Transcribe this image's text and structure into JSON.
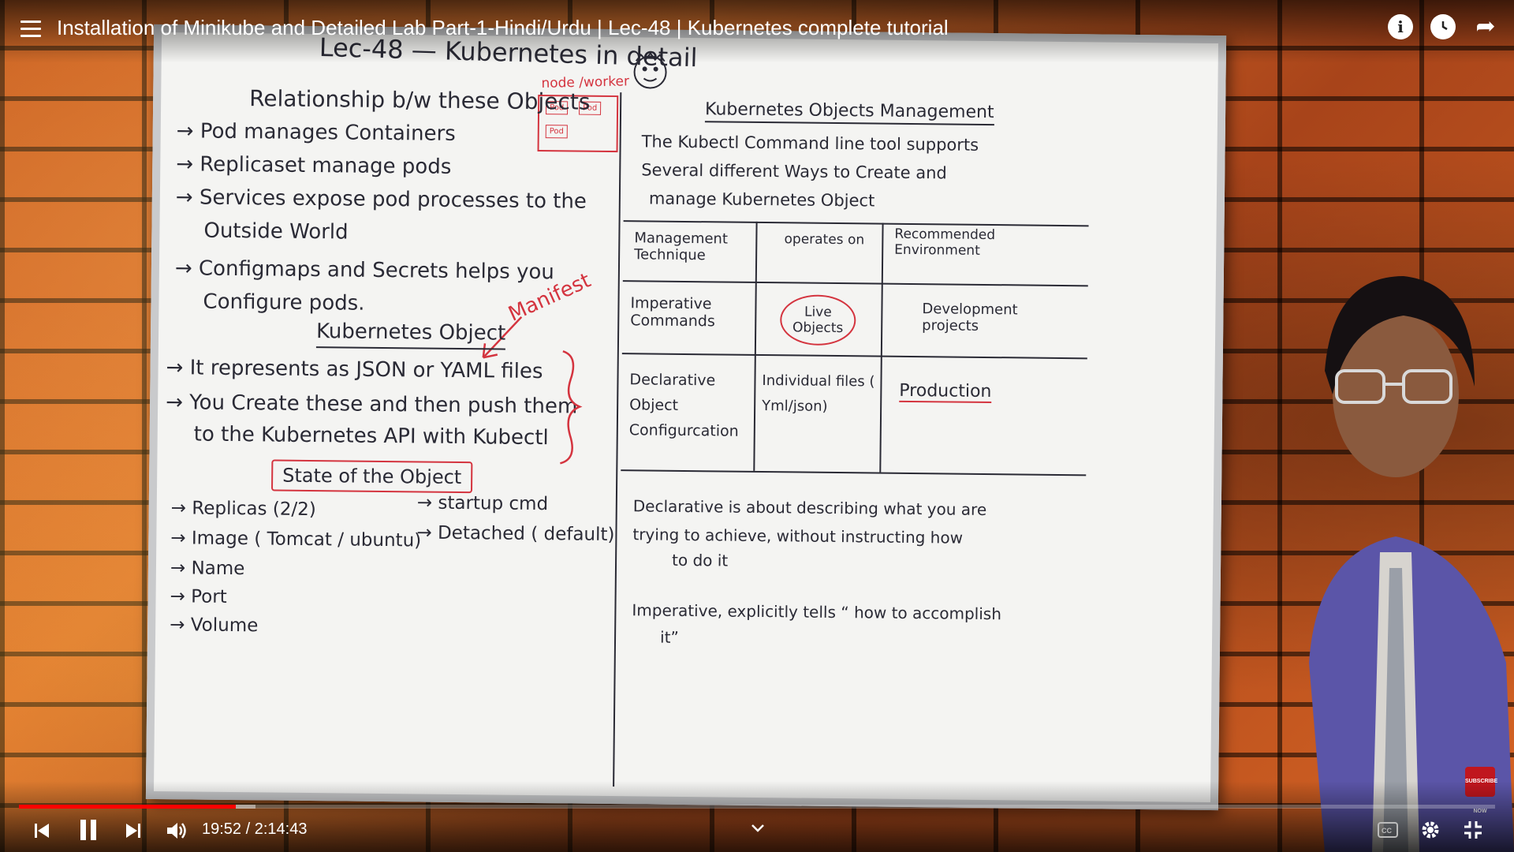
{
  "video": {
    "title": "Installation of Minikube and Detailed Lab Part-1-Hindi/Urdu | Lec-48 | Kubernetes complete tutorial",
    "current_time": "19:52",
    "duration": "2:14:43",
    "time_display": "19:52 / 2:14:43",
    "progress_fraction": 0.147,
    "buffered_fraction": 0.16
  },
  "top_controls": {
    "info_icon": "info-icon",
    "watch_later_icon": "clock-icon",
    "share_icon": "share-icon"
  },
  "bottom_controls": {
    "prev_icon": "skip-previous-icon",
    "pause_icon": "pause-icon",
    "next_icon": "skip-next-icon",
    "volume_icon": "volume-icon",
    "chapters_icon": "chevron-down-icon",
    "cc_icon": "captions-icon",
    "settings_icon": "gear-icon",
    "fullscreen_icon": "exit-fullscreen-icon"
  },
  "colors": {
    "progress_played": "#ff0000",
    "marker_red": "#d4343f",
    "marker_dark": "#2a2a35"
  },
  "board": {
    "header": "Lec-48 — Kubernetes in detail",
    "node_label": "node /worker",
    "pod_box_1": "Pod",
    "pod_box_2": "Pod",
    "pod_box_3": "Pod",
    "left": {
      "heading": "Relationship b/w these Objects",
      "points": [
        "→ Pod manages Containers",
        "→ Replicaset manage pods",
        "→ Services expose pod processes to the",
        "Outside World",
        "→ Configmaps and Secrets helps you",
        "Configure pods."
      ],
      "manifest": "Manifest",
      "object_heading": "Kubernetes Object",
      "object_points": [
        "→ It represents as JSON or YAML files",
        "→ You Create these and then push them",
        "to the Kubernetes API with Kubectl"
      ],
      "state_box": "State of the Object",
      "state_items": [
        "→ Replicas (2/2)",
        "→ Image ( Tomcat / ubuntu)",
        "→ Name",
        "→ Port",
        "→ Volume"
      ],
      "state_right": [
        "→ startup cmd",
        "→ Detached ( default)"
      ]
    },
    "right": {
      "heading": "Kubernetes Objects Management",
      "intro": [
        "The Kubectl Command line tool supports",
        "Several different Ways to Create and",
        "manage Kubernetes Object"
      ],
      "table": {
        "headers": [
          "Management Technique",
          "operates on",
          "Recommended Environment"
        ],
        "rows": [
          [
            "Imperative Commands",
            "Live Objects",
            "Development projects"
          ],
          [
            "Declarative Object Configurcation",
            "Individual files ( Yml/json)",
            "Production"
          ]
        ]
      },
      "notes": [
        "Declarative is about describing what you are",
        "trying to achieve, without instructing how",
        "to do it",
        "Imperative, explicitly tells “ how to accomplish",
        "it”"
      ]
    }
  },
  "channel_badge": "SUBSCRIBE NOW"
}
